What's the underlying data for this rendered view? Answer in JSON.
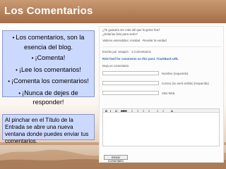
{
  "header": {
    "title": "Los Comentarios"
  },
  "bullets": [
    "Los comentarios, son la esencia del blog.",
    "¡Comenta!",
    "¡Lee los comentarios!",
    "¡Comenta los comentarios!",
    "¡Nunca de dejes de responder!"
  ],
  "note": "Al pinchar en el Título de la Entrada se abre una nueva ventana donde puedes enviar tus comentarios.",
  "screenshot": {
    "q1": "¿Te gustaría ser más útil que la gente fea?",
    "q2": "¿Estarías listo para serlo?",
    "votes": "Valores entendidos: Amidad · Revelar la verdad",
    "meta": "Escrito por Joaquín · 1 Comentarios",
    "rss": "RSS feed for comments on this post. TrackBack URL",
    "leave_reply": "Deja un comentario",
    "fields": [
      "Nombre (requerido)",
      "Correo (no será visible) (requerido)",
      "Sitio Web"
    ],
    "toolbar": [
      "B",
      "I",
      "U",
      "ABC",
      "≡",
      "≡",
      "≡",
      "≡",
      "≡",
      "≡",
      "A"
    ],
    "submit": "Enviar Comentario"
  }
}
